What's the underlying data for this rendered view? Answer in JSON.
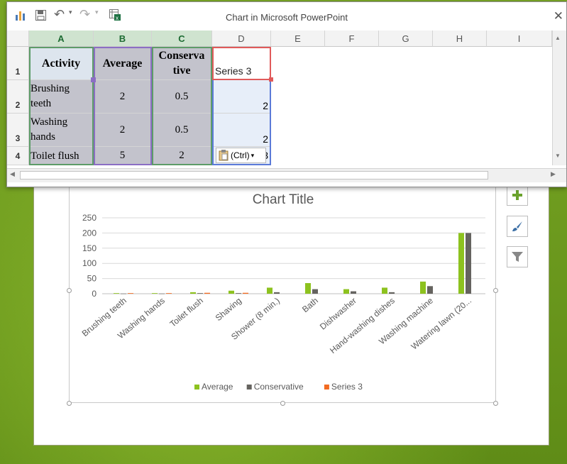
{
  "window": {
    "title": "Chart in Microsoft PowerPoint",
    "close_icon": "close-icon"
  },
  "quick_access": {
    "icons": [
      "chart-icon",
      "save-icon",
      "undo-icon",
      "redo-icon",
      "edit-data-in-excel-icon"
    ]
  },
  "sheet": {
    "columns": [
      "A",
      "B",
      "C",
      "D",
      "E",
      "F",
      "G",
      "H",
      "I"
    ],
    "rows": [
      "1",
      "2",
      "3",
      "4"
    ],
    "headers": [
      "Activity",
      "Average",
      "Conservative",
      "Series 3"
    ],
    "header_display": {
      "conservative": "Conserva\ntive"
    },
    "data": [
      [
        "Brushing\nteeth",
        "2",
        "0.5",
        "2"
      ],
      [
        "Washing\nhands",
        "2",
        "0.5",
        "2"
      ],
      [
        "Toilet flush",
        "5",
        "2",
        "3"
      ]
    ],
    "paste_options": "(Ctrl)"
  },
  "chart_data": {
    "type": "bar",
    "title": "Chart Title",
    "categories": [
      "Brushing teeth",
      "Washing hands",
      "Toilet flush",
      "Shaving",
      "Shower (8 min.)",
      "Bath",
      "Dishwasher",
      "Hand-washing dishes",
      "Washing machine",
      "Watering lawn (20..."
    ],
    "series": [
      {
        "name": "Average",
        "color": "#8dc21f",
        "values": [
          2,
          2,
          5,
          10,
          20,
          35,
          15,
          20,
          40,
          200
        ]
      },
      {
        "name": "Conservative",
        "color": "#65635f",
        "values": [
          0.5,
          0.5,
          2,
          2,
          5,
          15,
          8,
          5,
          25,
          200
        ]
      },
      {
        "name": "Series 3",
        "color": "#f26b21",
        "values": [
          2,
          2,
          3,
          3,
          0,
          0,
          0,
          0,
          0,
          0
        ]
      }
    ],
    "ylim": [
      0,
      250
    ],
    "yticks": [
      "0",
      "50",
      "100",
      "150",
      "200",
      "250"
    ],
    "legend_position": "bottom",
    "grid": true
  },
  "side_buttons": [
    "chart-elements-icon",
    "chart-styles-icon",
    "chart-filters-icon"
  ]
}
